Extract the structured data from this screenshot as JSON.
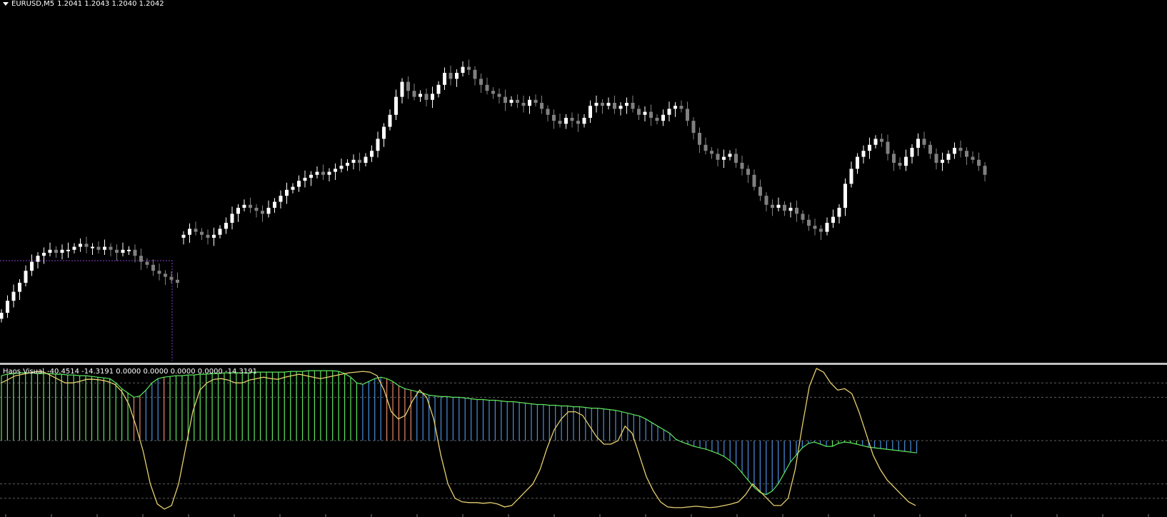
{
  "chart_header": {
    "symbol": "EURUSD,M5",
    "values": "1.2041 1.2043 1.2040 1.2042"
  },
  "indicator_header": {
    "name": "Haos Visual",
    "values": "-40.4514 -14.3191 0.0000 0.0000 0.0000 0.0000 -14.3191"
  },
  "colors": {
    "background": "#000000",
    "bull_candle": "#ffffff",
    "bear_candle": "#808080",
    "hist_green": "#5ee65e",
    "hist_blue": "#4a8fe0",
    "hist_salmon": "#e8876a",
    "signal_line": "#e8d070",
    "level_line": "#606060",
    "separator": "#c0c0c0",
    "box": "#8a3fd0"
  },
  "chart_data": [
    {
      "type": "candlestick",
      "title": "EURUSD,M5",
      "ohlc_last": [
        1.2041,
        1.2043,
        1.204,
        1.2042
      ],
      "close_series": [
        0.1,
        0.14,
        0.17,
        0.2,
        0.24,
        0.27,
        0.29,
        0.3,
        0.31,
        0.3,
        0.31,
        0.31,
        0.32,
        0.33,
        0.32,
        0.32,
        0.31,
        0.32,
        0.31,
        0.3,
        0.31,
        0.31,
        0.29,
        0.27,
        0.26,
        0.24,
        0.23,
        0.22,
        0.21,
        0.2,
        0.36,
        0.38,
        0.37,
        0.36,
        0.35,
        0.36,
        0.38,
        0.4,
        0.43,
        0.45,
        0.46,
        0.45,
        0.44,
        0.43,
        0.45,
        0.47,
        0.49,
        0.51,
        0.52,
        0.54,
        0.55,
        0.56,
        0.57,
        0.56,
        0.57,
        0.58,
        0.59,
        0.6,
        0.61,
        0.6,
        0.62,
        0.64,
        0.68,
        0.72,
        0.76,
        0.82,
        0.87,
        0.84,
        0.82,
        0.83,
        0.81,
        0.83,
        0.86,
        0.9,
        0.88,
        0.9,
        0.92,
        0.91,
        0.88,
        0.86,
        0.84,
        0.83,
        0.82,
        0.8,
        0.81,
        0.8,
        0.79,
        0.81,
        0.8,
        0.78,
        0.76,
        0.74,
        0.73,
        0.75,
        0.74,
        0.73,
        0.75,
        0.79,
        0.8,
        0.79,
        0.8,
        0.78,
        0.79,
        0.8,
        0.78,
        0.76,
        0.77,
        0.75,
        0.74,
        0.76,
        0.78,
        0.79,
        0.78,
        0.74,
        0.7,
        0.66,
        0.64,
        0.63,
        0.61,
        0.62,
        0.63,
        0.6,
        0.58,
        0.56,
        0.52,
        0.49,
        0.46,
        0.45,
        0.46,
        0.44,
        0.45,
        0.43,
        0.41,
        0.39,
        0.38,
        0.37,
        0.4,
        0.42,
        0.45,
        0.53,
        0.58,
        0.62,
        0.64,
        0.66,
        0.68,
        0.67,
        0.63,
        0.6,
        0.59,
        0.62,
        0.65,
        0.68,
        0.66,
        0.63,
        0.6,
        0.61,
        0.63,
        0.65,
        0.64,
        0.62,
        0.61,
        0.59,
        0.56
      ]
    },
    {
      "type": "bar",
      "title": "Haos Visual",
      "levels": [
        80,
        60,
        0,
        -60,
        -80
      ],
      "histogram": [
        90,
        92,
        93,
        94,
        94,
        94,
        93,
        93,
        93,
        92,
        92,
        91,
        91,
        90,
        90,
        89,
        88,
        87,
        86,
        80,
        72,
        66,
        60,
        62,
        70,
        80,
        86,
        88,
        89,
        90,
        90,
        91,
        91,
        92,
        92,
        93,
        93,
        94,
        94,
        94,
        94,
        94,
        95,
        95,
        95,
        95,
        95,
        95,
        96,
        96,
        96,
        97,
        97,
        97,
        97,
        97,
        96,
        93,
        88,
        80,
        78,
        82,
        86,
        88,
        86,
        82,
        76,
        72,
        70,
        68,
        66,
        63,
        62,
        61,
        61,
        60,
        60,
        59,
        58,
        57,
        57,
        56,
        56,
        55,
        54,
        54,
        53,
        52,
        51,
        50,
        50,
        49,
        49,
        48,
        48,
        47,
        47,
        46,
        45,
        45,
        44,
        43,
        42,
        40,
        38,
        36,
        34,
        30,
        25,
        20,
        15,
        10,
        2,
        -2,
        -5,
        -8,
        -10,
        -12,
        -15,
        -18,
        -22,
        -28,
        -35,
        -45,
        -55,
        -65,
        -72,
        -75,
        -70,
        -60,
        -45,
        -30,
        -20,
        -10,
        -4,
        -2,
        -5,
        -8,
        -8,
        -4,
        -2,
        -3,
        -5,
        -7,
        -9,
        -10,
        -11,
        -12,
        -13,
        -14,
        -15,
        -16,
        -17
      ],
      "hist_colors": "ggggggggggggggggggggggssbbbsggggggggggggggggggggggggggggggggbbbbsssssbbbbbbbbbbbbbbbbbbbbbbbbbbbbbbbbbbbbbbbbbbbbbbbbbbbbbbbbbbbbbbbbbbbbbgggggbbbbbbbbbbbbbbbbbbbbbb",
      "signal": [
        80,
        85,
        90,
        92,
        94,
        96,
        95,
        90,
        85,
        80,
        80,
        82,
        85,
        85,
        84,
        82,
        78,
        68,
        50,
        20,
        -15,
        -60,
        -88,
        -95,
        -90,
        -60,
        -10,
        40,
        70,
        80,
        85,
        86,
        84,
        80,
        80,
        84,
        86,
        88,
        86,
        85,
        88,
        90,
        92,
        90,
        88,
        86,
        88,
        90,
        92,
        94,
        95,
        96,
        95,
        90,
        70,
        40,
        30,
        35,
        55,
        70,
        60,
        30,
        -20,
        -60,
        -80,
        -85,
        -86,
        -86,
        -87,
        -86,
        -88,
        -92,
        -90,
        -80,
        -70,
        -60,
        -40,
        -10,
        15,
        30,
        40,
        40,
        35,
        20,
        5,
        -5,
        -5,
        0,
        20,
        10,
        -20,
        -50,
        -70,
        -85,
        -92,
        -93,
        -93,
        -92,
        -91,
        -92,
        -93,
        -92,
        -90,
        -88,
        -85,
        -75,
        -60,
        -70,
        -80,
        -90,
        -90,
        -80,
        -40,
        20,
        75,
        100,
        95,
        80,
        70,
        72,
        65,
        40,
        10,
        -20,
        -40,
        -55,
        -65,
        -75,
        -85,
        -90
      ]
    }
  ]
}
